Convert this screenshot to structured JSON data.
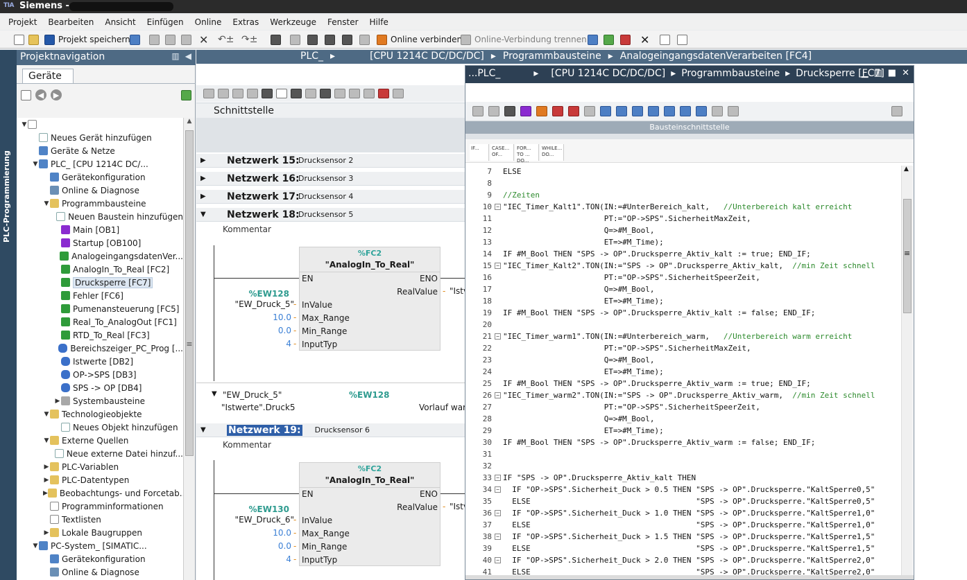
{
  "app": {
    "title": "Siemens  -",
    "logo": "TIA"
  },
  "menu": [
    "Projekt",
    "Bearbeiten",
    "Ansicht",
    "Einfügen",
    "Online",
    "Extras",
    "Werkzeuge",
    "Fenster",
    "Hilfe"
  ],
  "toolbar": {
    "save_label": "Projekt speichern",
    "online_label": "Online verbinden",
    "offline_label": "Online-Verbindung trennen"
  },
  "side_strip": "PLC-Programmierung",
  "projnav": {
    "title": "Projektnavigation",
    "tab": "Geräte",
    "tree": [
      {
        "label": "",
        "level": 0,
        "icon": "doc",
        "toggle": "▼"
      },
      {
        "label": "Neues Gerät hinzufügen",
        "level": 1,
        "icon": "add",
        "toggle": ""
      },
      {
        "label": "Geräte & Netze",
        "level": 1,
        "icon": "dev",
        "toggle": ""
      },
      {
        "label": "PLC_          [CPU 1214C DC/...",
        "level": 1,
        "icon": "dev",
        "toggle": "▼"
      },
      {
        "label": "Gerätekonfiguration",
        "level": 2,
        "icon": "dev",
        "toggle": ""
      },
      {
        "label": "Online & Diagnose",
        "level": 2,
        "icon": "diag",
        "toggle": ""
      },
      {
        "label": "Programmbausteine",
        "level": 2,
        "icon": "fold",
        "toggle": "▼"
      },
      {
        "label": "Neuen Baustein hinzufügen",
        "level": 3,
        "icon": "add",
        "toggle": ""
      },
      {
        "label": "Main [OB1]",
        "level": 3,
        "icon": "ob",
        "toggle": ""
      },
      {
        "label": "Startup [OB100]",
        "level": 3,
        "icon": "ob",
        "toggle": ""
      },
      {
        "label": "AnalogeingangsdatenVer...",
        "level": 3,
        "icon": "fc",
        "toggle": ""
      },
      {
        "label": "AnalogIn_To_Real [FC2]",
        "level": 3,
        "icon": "fc",
        "toggle": ""
      },
      {
        "label": "Drucksperre [FC7]",
        "level": 3,
        "icon": "fc",
        "toggle": "",
        "selected": true
      },
      {
        "label": "Fehler [FC6]",
        "level": 3,
        "icon": "fc",
        "toggle": ""
      },
      {
        "label": "Pumenansteuerung [FC5]",
        "level": 3,
        "icon": "fc",
        "toggle": ""
      },
      {
        "label": "Real_To_AnalogOut [FC1]",
        "level": 3,
        "icon": "fc",
        "toggle": ""
      },
      {
        "label": "RTD_To_Real [FC3]",
        "level": 3,
        "icon": "fc",
        "toggle": ""
      },
      {
        "label": "Bereichszeiger_PC_Prog [...",
        "level": 3,
        "icon": "db",
        "toggle": ""
      },
      {
        "label": "Istwerte [DB2]",
        "level": 3,
        "icon": "db",
        "toggle": ""
      },
      {
        "label": "OP->SPS [DB3]",
        "level": 3,
        "icon": "db",
        "toggle": ""
      },
      {
        "label": "SPS -> OP [DB4]",
        "level": 3,
        "icon": "db",
        "toggle": ""
      },
      {
        "label": "Systembausteine",
        "level": 3,
        "icon": "gray",
        "toggle": "▶"
      },
      {
        "label": "Technologieobjekte",
        "level": 2,
        "icon": "fold",
        "toggle": "▼"
      },
      {
        "label": "Neues Objekt hinzufügen",
        "level": 3,
        "icon": "add",
        "toggle": ""
      },
      {
        "label": "Externe Quellen",
        "level": 2,
        "icon": "fold",
        "toggle": "▼"
      },
      {
        "label": "Neue externe Datei hinzuf...",
        "level": 3,
        "icon": "add",
        "toggle": ""
      },
      {
        "label": "PLC-Variablen",
        "level": 2,
        "icon": "fold",
        "toggle": "▶"
      },
      {
        "label": "PLC-Datentypen",
        "level": 2,
        "icon": "fold",
        "toggle": "▶"
      },
      {
        "label": "Beobachtungs- und Forcetab...",
        "level": 2,
        "icon": "fold",
        "toggle": "▶"
      },
      {
        "label": "Programminformationen",
        "level": 2,
        "icon": "doc",
        "toggle": ""
      },
      {
        "label": "Textlisten",
        "level": 2,
        "icon": "doc",
        "toggle": ""
      },
      {
        "label": "Lokale Baugruppen",
        "level": 2,
        "icon": "fold",
        "toggle": "▶"
      },
      {
        "label": "PC-System_          [SIMATIC...",
        "level": 1,
        "icon": "dev",
        "toggle": "▼"
      },
      {
        "label": "Gerätekonfiguration",
        "level": 2,
        "icon": "dev",
        "toggle": ""
      },
      {
        "label": "Online & Diagnose",
        "level": 2,
        "icon": "diag",
        "toggle": ""
      }
    ]
  },
  "main_breadcrumb": [
    "PLC_",
    "▸",
    "[CPU 1214C DC/DC/DC]",
    "▸",
    "Programmbausteine",
    "▸",
    "AnalogeingangsdatenVerarbeiten [FC4]"
  ],
  "interface_label": "Schnittstelle",
  "networks_top": [
    {
      "head": "Netzwerk 15:",
      "desc": "Drucksensor 2"
    },
    {
      "head": "Netzwerk 16:",
      "desc": "Drucksensor 3"
    },
    {
      "head": "Netzwerk 17:",
      "desc": "Drucksensor 4"
    },
    {
      "head": "Netzwerk 18:",
      "desc": "Drucksensor 5"
    }
  ],
  "network19": {
    "head": "Netzwerk 19:",
    "desc": "Drucksensor 6"
  },
  "comment_label": "Kommentar",
  "fb1": {
    "id": "%FC2",
    "name": "\"AnalogIn_To_Real\"",
    "en": "EN",
    "eno": "ENO",
    "realvalue": "RealValue",
    "out": "\"Istv",
    "inputs": [
      "InValue",
      "Max_Range",
      "Min_Range",
      "InputTyp"
    ],
    "addr": "%EW128",
    "sym": "\"EW_Druck_5\"",
    "vals": [
      "10.0",
      "0.0",
      "4"
    ]
  },
  "fb2": {
    "id": "%FC2",
    "name": "\"AnalogIn_To_Real\"",
    "en": "EN",
    "eno": "ENO",
    "realvalue": "RealValue",
    "out": "\"Istv",
    "inputs": [
      "InValue",
      "Max_Range",
      "Min_Range",
      "InputTyp"
    ],
    "addr": "%EW130",
    "sym": "\"EW_Druck_6\"",
    "vals": [
      "10.0",
      "0.0",
      "4"
    ]
  },
  "xref": {
    "sym": "\"EW_Druck_5\"",
    "addr": "%EW128",
    "target": "\"Istwerte\".Druck5",
    "comment": "Vorlauf warm"
  },
  "fw": {
    "breadcrumb": [
      "...PLC_",
      "▸",
      "[CPU 1214C DC/DC/DC]",
      "▸",
      "Programmbausteine",
      "▸",
      "Drucksperre [FC7]"
    ],
    "iface": "Bausteinschnittstelle",
    "snippets": [
      "IF...",
      "CASE... OF...",
      "FOR... TO ... DO...",
      "WHILE... DO..."
    ],
    "lines": [
      {
        "n": "7",
        "f": "",
        "t": "ELSE"
      },
      {
        "n": "8",
        "f": "",
        "t": ""
      },
      {
        "n": "9",
        "f": "",
        "t": "//Zeiten",
        "c": true
      },
      {
        "n": "10",
        "f": "⊟",
        "t": "\"IEC_Timer_Kalt1\".TON(IN:=#UnterBereich_kalt,   //Unterbereich kalt erreicht"
      },
      {
        "n": "11",
        "f": "",
        "t": "                      PT:=\"OP->SPS\".SicherheitMaxZeit,"
      },
      {
        "n": "12",
        "f": "",
        "t": "                      Q=>#M_Bool,"
      },
      {
        "n": "13",
        "f": "",
        "t": "                      ET=>#M_Time);"
      },
      {
        "n": "14",
        "f": "",
        "t": "IF #M_Bool THEN \"SPS -> OP\".Drucksperre_Aktiv_kalt := true; END_IF;"
      },
      {
        "n": "15",
        "f": "⊟",
        "t": "\"IEC_Timer_Kalt2\".TON(IN:=\"SPS -> OP\".Drucksperre_Aktiv_kalt,  //min Zeit schnell"
      },
      {
        "n": "16",
        "f": "",
        "t": "                      PT:=\"OP->SPS\".SicherheitSpeerZeit,"
      },
      {
        "n": "17",
        "f": "",
        "t": "                      Q=>#M_Bool,"
      },
      {
        "n": "18",
        "f": "",
        "t": "                      ET=>#M_Time);"
      },
      {
        "n": "19",
        "f": "",
        "t": "IF #M_Bool THEN \"SPS -> OP\".Drucksperre_Aktiv_kalt := false; END_IF;"
      },
      {
        "n": "20",
        "f": "",
        "t": ""
      },
      {
        "n": "21",
        "f": "⊟",
        "t": "\"IEC_Timer_warm1\".TON(IN:=#Unterbereich_warm,   //Unterbereich warm erreicht"
      },
      {
        "n": "22",
        "f": "",
        "t": "                      PT:=\"OP->SPS\".SicherheitMaxZeit,"
      },
      {
        "n": "23",
        "f": "",
        "t": "                      Q=>#M_Bool,"
      },
      {
        "n": "24",
        "f": "",
        "t": "                      ET=>#M_Time);"
      },
      {
        "n": "25",
        "f": "",
        "t": "IF #M_Bool THEN \"SPS -> OP\".Drucksperre_Aktiv_warm := true; END_IF;"
      },
      {
        "n": "26",
        "f": "⊟",
        "t": "\"IEC_Timer_warm2\".TON(IN:=\"SPS -> OP\".Drucksperre_Aktiv_warm,  //min Zeit schnell"
      },
      {
        "n": "27",
        "f": "",
        "t": "                      PT:=\"OP->SPS\".SicherheitSpeerZeit,"
      },
      {
        "n": "28",
        "f": "",
        "t": "                      Q=>#M_Bool,"
      },
      {
        "n": "29",
        "f": "",
        "t": "                      ET=>#M_Time);"
      },
      {
        "n": "30",
        "f": "",
        "t": "IF #M_Bool THEN \"SPS -> OP\".Drucksperre_Aktiv_warm := false; END_IF;"
      },
      {
        "n": "31",
        "f": "",
        "t": ""
      },
      {
        "n": "32",
        "f": "",
        "t": ""
      },
      {
        "n": "33",
        "f": "⊟",
        "t": "IF \"SPS -> OP\".Drucksperre_Aktiv_kalt THEN"
      },
      {
        "n": "34",
        "f": "⊟",
        "t": "  IF \"OP->SPS\".Sicherheit_Duck > 0.5 THEN \"SPS -> OP\".Drucksperre.\"KaltSperre0,5\""
      },
      {
        "n": "35",
        "f": "",
        "t": "  ELSE                                    \"SPS -> OP\".Drucksperre.\"KaltSperre0,5\""
      },
      {
        "n": "36",
        "f": "⊟",
        "t": "  IF \"OP->SPS\".Sicherheit_Duck > 1.0 THEN \"SPS -> OP\".Drucksperre.\"KaltSperre1,0\""
      },
      {
        "n": "37",
        "f": "",
        "t": "  ELSE                                    \"SPS -> OP\".Drucksperre.\"KaltSperre1,0\""
      },
      {
        "n": "38",
        "f": "⊟",
        "t": "  IF \"OP->SPS\".Sicherheit_Duck > 1.5 THEN \"SPS -> OP\".Drucksperre.\"KaltSperre1,5\""
      },
      {
        "n": "39",
        "f": "",
        "t": "  ELSE                                    \"SPS -> OP\".Drucksperre.\"KaltSperre1,5\""
      },
      {
        "n": "40",
        "f": "⊟",
        "t": "  IF \"OP->SPS\".Sicherheit_Duck > 2.0 THEN \"SPS -> OP\".Drucksperre.\"KaltSperre2,0\""
      },
      {
        "n": "41",
        "f": "",
        "t": "  ELSE                                    \"SPS -> OP\".Drucksperre.\"KaltSperre2,0\""
      }
    ]
  }
}
